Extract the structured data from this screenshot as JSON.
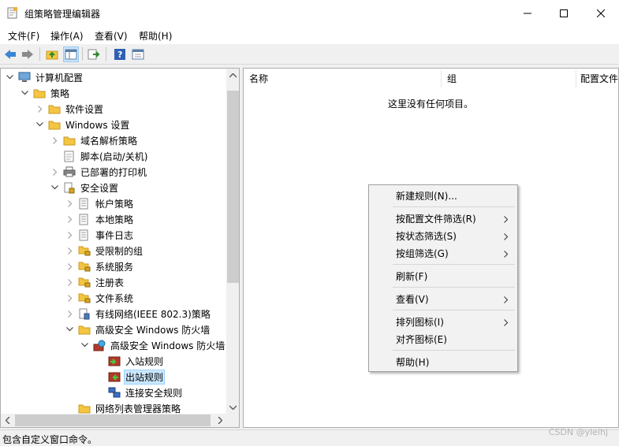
{
  "window": {
    "title": "组策略管理编辑器"
  },
  "menubar": {
    "items": [
      "文件(F)",
      "操作(A)",
      "查看(V)",
      "帮助(H)"
    ]
  },
  "toolbar": {
    "icons": [
      "back-icon",
      "forward-icon",
      "up-folder-icon",
      "show-tree-icon",
      "export-icon",
      "help-icon",
      "properties-icon"
    ]
  },
  "tree": {
    "nodes": [
      {
        "label": "计算机配置",
        "icon": "computer-icon",
        "expanded": true
      },
      {
        "label": "策略",
        "icon": "folder-icon",
        "expanded": true
      },
      {
        "label": "软件设置",
        "icon": "folder-icon",
        "expanded": false
      },
      {
        "label": "Windows 设置",
        "icon": "folder-icon",
        "expanded": true
      },
      {
        "label": "域名解析策略",
        "icon": "folder-icon",
        "expanded": false
      },
      {
        "label": "脚本(启动/关机)",
        "icon": "script-icon",
        "expanded": null
      },
      {
        "label": "已部署的打印机",
        "icon": "printer-icon",
        "expanded": false
      },
      {
        "label": "安全设置",
        "icon": "security-settings-icon",
        "expanded": true
      },
      {
        "label": "帐户策略",
        "icon": "policy-icon",
        "expanded": false
      },
      {
        "label": "本地策略",
        "icon": "policy-icon",
        "expanded": false
      },
      {
        "label": "事件日志",
        "icon": "policy-icon",
        "expanded": false
      },
      {
        "label": "受限制的组",
        "icon": "locked-folder-icon",
        "expanded": false
      },
      {
        "label": "系统服务",
        "icon": "locked-folder-icon",
        "expanded": false
      },
      {
        "label": "注册表",
        "icon": "locked-folder-icon",
        "expanded": false
      },
      {
        "label": "文件系统",
        "icon": "locked-folder-icon",
        "expanded": false
      },
      {
        "label": "有线网络(IEEE 802.3)策略",
        "icon": "network-policy-icon",
        "expanded": false
      },
      {
        "label": "高级安全 Windows 防火墙",
        "icon": "folder-icon",
        "expanded": true
      },
      {
        "label": "高级安全 Windows 防火墙",
        "icon": "firewall-icon",
        "expanded": true
      },
      {
        "label": "入站规则",
        "icon": "inbound-rules-icon",
        "expanded": null
      },
      {
        "label": "出站规则",
        "icon": "outbound-rules-icon",
        "expanded": null,
        "selected": true
      },
      {
        "label": "连接安全规则",
        "icon": "connection-security-icon",
        "expanded": null
      },
      {
        "label": "网络列表管理器策略",
        "icon": "folder-icon",
        "expanded": null
      }
    ]
  },
  "list": {
    "columns": [
      "名称",
      "组",
      "配置文件"
    ],
    "empty_message": "这里没有任何项目。"
  },
  "context_menu": {
    "items": [
      {
        "label": "新建规则(N)...",
        "submenu": false
      },
      {
        "label": "按配置文件筛选(R)",
        "submenu": true
      },
      {
        "label": "按状态筛选(S)",
        "submenu": true
      },
      {
        "label": "按组筛选(G)",
        "submenu": true
      },
      {
        "label": "刷新(F)",
        "submenu": false
      },
      {
        "label": "查看(V)",
        "submenu": true
      },
      {
        "label": "排列图标(I)",
        "submenu": true
      },
      {
        "label": "对齐图标(E)",
        "submenu": false
      },
      {
        "label": "帮助(H)",
        "submenu": false
      }
    ]
  },
  "statusbar": {
    "text": "包含自定义窗口命令。"
  },
  "watermark": {
    "text": "CSDN @yleihj"
  },
  "colors": {
    "selection": "#cce8ff",
    "folder": "#f4c542",
    "accent": "#0078d7"
  }
}
